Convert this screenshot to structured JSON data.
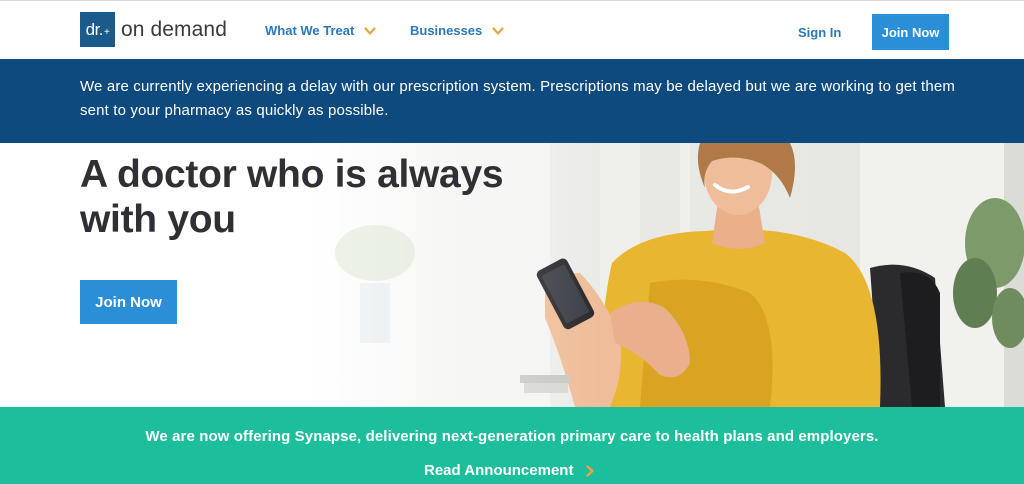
{
  "header": {
    "logo_mark": "dr.",
    "logo_plus": "+",
    "logo_text": "on demand",
    "nav": [
      {
        "label": "What We Treat"
      },
      {
        "label": "Businesses"
      }
    ],
    "sign_in": "Sign In",
    "join_now": "Join Now"
  },
  "alert": {
    "text": "We are currently experiencing a delay with our prescription system. Prescriptions may be delayed but we are working to get them sent to your pharmacy as quickly as possible."
  },
  "hero": {
    "title": "A doctor who is always with you",
    "cta": "Join Now"
  },
  "announcement": {
    "text": "We are now offering Synapse, delivering next-generation primary care to health plans and employers.",
    "link": "Read Announcement"
  },
  "colors": {
    "brand_navy": "#0f4a7e",
    "brand_blue": "#2b8fd8",
    "link_blue": "#2b78b9",
    "teal": "#1dbe9b",
    "chevron_gold": "#e0a93b"
  }
}
